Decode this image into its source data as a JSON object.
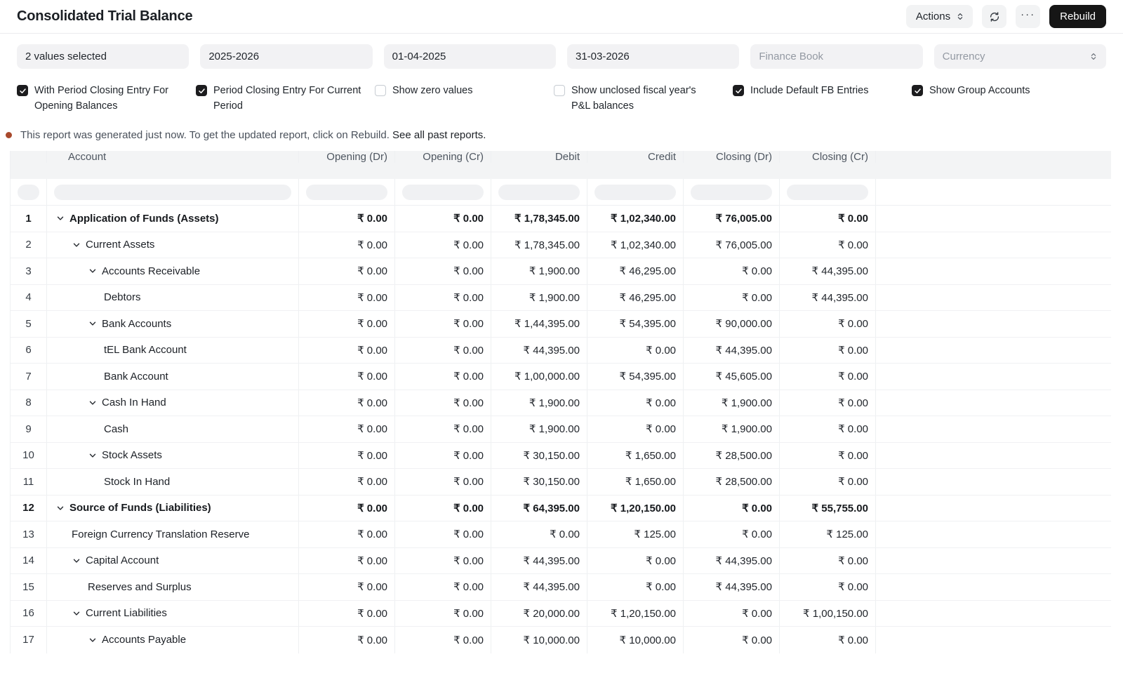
{
  "header": {
    "title": "Consolidated Trial Balance",
    "actions_label": "Actions",
    "rebuild_label": "Rebuild",
    "refresh_icon": "refresh-icon",
    "menu_icon": "ellipsis-icon",
    "ellipsis_glyph": "···"
  },
  "filters": {
    "company": {
      "value": "2 values selected"
    },
    "fiscal_year": {
      "value": "2025-2026"
    },
    "from_date": {
      "value": "01-04-2025"
    },
    "to_date": {
      "value": "31-03-2026"
    },
    "finance_book": {
      "placeholder": "Finance Book"
    },
    "currency": {
      "placeholder": "Currency"
    }
  },
  "checkboxes": [
    {
      "label": "With Period Closing Entry For Opening Balances",
      "checked": true
    },
    {
      "label": "Period Closing Entry For Current Period",
      "checked": true
    },
    {
      "label": "Show zero values",
      "checked": false
    },
    {
      "label": "Show unclosed fiscal year's P&L balances",
      "checked": false
    },
    {
      "label": "Include Default FB Entries",
      "checked": true
    },
    {
      "label": "Show Group Accounts",
      "checked": true
    }
  ],
  "notice": {
    "text": "This report was generated just now. To get the updated report, click on Rebuild.",
    "link": "See all past reports."
  },
  "table": {
    "columns": [
      "Account",
      "Opening (Dr)",
      "Opening (Cr)",
      "Debit",
      "Credit",
      "Closing (Dr)",
      "Closing (Cr)"
    ],
    "rows": [
      {
        "num": 1,
        "account": "Application of Funds (Assets)",
        "indent": 0,
        "expandable": true,
        "bold": true,
        "values": [
          "₹ 0.00",
          "₹ 0.00",
          "₹ 1,78,345.00",
          "₹ 1,02,340.00",
          "₹ 76,005.00",
          "₹ 0.00"
        ]
      },
      {
        "num": 2,
        "account": "Current Assets",
        "indent": 1,
        "expandable": true,
        "bold": false,
        "values": [
          "₹ 0.00",
          "₹ 0.00",
          "₹ 1,78,345.00",
          "₹ 1,02,340.00",
          "₹ 76,005.00",
          "₹ 0.00"
        ]
      },
      {
        "num": 3,
        "account": "Accounts Receivable",
        "indent": 2,
        "expandable": true,
        "bold": false,
        "values": [
          "₹ 0.00",
          "₹ 0.00",
          "₹ 1,900.00",
          "₹ 46,295.00",
          "₹ 0.00",
          "₹ 44,395.00"
        ]
      },
      {
        "num": 4,
        "account": "Debtors",
        "indent": 3,
        "expandable": false,
        "bold": false,
        "values": [
          "₹ 0.00",
          "₹ 0.00",
          "₹ 1,900.00",
          "₹ 46,295.00",
          "₹ 0.00",
          "₹ 44,395.00"
        ]
      },
      {
        "num": 5,
        "account": "Bank Accounts",
        "indent": 2,
        "expandable": true,
        "bold": false,
        "values": [
          "₹ 0.00",
          "₹ 0.00",
          "₹ 1,44,395.00",
          "₹ 54,395.00",
          "₹ 90,000.00",
          "₹ 0.00"
        ]
      },
      {
        "num": 6,
        "account": "tEL Bank Account",
        "indent": 3,
        "expandable": false,
        "bold": false,
        "values": [
          "₹ 0.00",
          "₹ 0.00",
          "₹ 44,395.00",
          "₹ 0.00",
          "₹ 44,395.00",
          "₹ 0.00"
        ]
      },
      {
        "num": 7,
        "account": "Bank Account",
        "indent": 3,
        "expandable": false,
        "bold": false,
        "values": [
          "₹ 0.00",
          "₹ 0.00",
          "₹ 1,00,000.00",
          "₹ 54,395.00",
          "₹ 45,605.00",
          "₹ 0.00"
        ]
      },
      {
        "num": 8,
        "account": "Cash In Hand",
        "indent": 2,
        "expandable": true,
        "bold": false,
        "values": [
          "₹ 0.00",
          "₹ 0.00",
          "₹ 1,900.00",
          "₹ 0.00",
          "₹ 1,900.00",
          "₹ 0.00"
        ]
      },
      {
        "num": 9,
        "account": "Cash",
        "indent": 3,
        "expandable": false,
        "bold": false,
        "values": [
          "₹ 0.00",
          "₹ 0.00",
          "₹ 1,900.00",
          "₹ 0.00",
          "₹ 1,900.00",
          "₹ 0.00"
        ]
      },
      {
        "num": 10,
        "account": "Stock Assets",
        "indent": 2,
        "expandable": true,
        "bold": false,
        "values": [
          "₹ 0.00",
          "₹ 0.00",
          "₹ 30,150.00",
          "₹ 1,650.00",
          "₹ 28,500.00",
          "₹ 0.00"
        ]
      },
      {
        "num": 11,
        "account": "Stock In Hand",
        "indent": 3,
        "expandable": false,
        "bold": false,
        "values": [
          "₹ 0.00",
          "₹ 0.00",
          "₹ 30,150.00",
          "₹ 1,650.00",
          "₹ 28,500.00",
          "₹ 0.00"
        ]
      },
      {
        "num": 12,
        "account": "Source of Funds (Liabilities)",
        "indent": 0,
        "expandable": true,
        "bold": true,
        "values": [
          "₹ 0.00",
          "₹ 0.00",
          "₹ 64,395.00",
          "₹ 1,20,150.00",
          "₹ 0.00",
          "₹ 55,755.00"
        ]
      },
      {
        "num": 13,
        "account": "Foreign Currency Translation Reserve",
        "indent": 1,
        "expandable": false,
        "bold": false,
        "values": [
          "₹ 0.00",
          "₹ 0.00",
          "₹ 0.00",
          "₹ 125.00",
          "₹ 0.00",
          "₹ 125.00"
        ]
      },
      {
        "num": 14,
        "account": "Capital Account",
        "indent": 1,
        "expandable": true,
        "bold": false,
        "values": [
          "₹ 0.00",
          "₹ 0.00",
          "₹ 44,395.00",
          "₹ 0.00",
          "₹ 44,395.00",
          "₹ 0.00"
        ]
      },
      {
        "num": 15,
        "account": "Reserves and Surplus",
        "indent": 2,
        "expandable": false,
        "bold": false,
        "values": [
          "₹ 0.00",
          "₹ 0.00",
          "₹ 44,395.00",
          "₹ 0.00",
          "₹ 44,395.00",
          "₹ 0.00"
        ]
      },
      {
        "num": 16,
        "account": "Current Liabilities",
        "indent": 1,
        "expandable": true,
        "bold": false,
        "values": [
          "₹ 0.00",
          "₹ 0.00",
          "₹ 20,000.00",
          "₹ 1,20,150.00",
          "₹ 0.00",
          "₹ 1,00,150.00"
        ]
      },
      {
        "num": 17,
        "account": "Accounts Payable",
        "indent": 2,
        "expandable": true,
        "bold": false,
        "values": [
          "₹ 0.00",
          "₹ 0.00",
          "₹ 10,000.00",
          "₹ 10,000.00",
          "₹ 0.00",
          "₹ 0.00"
        ]
      }
    ]
  },
  "colors": {
    "accent_dark": "#161616",
    "header_band": "#f3f4f5",
    "notice_dot": "#a8492c",
    "checkbox_checked": "#1c1c1e"
  }
}
